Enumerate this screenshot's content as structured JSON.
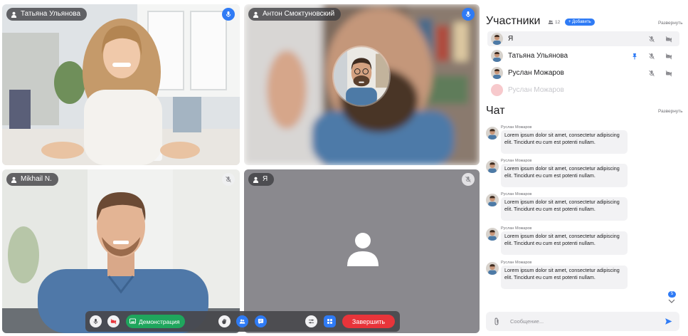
{
  "video_tiles": [
    {
      "name": "Татьяна Ульянова",
      "mic": "on"
    },
    {
      "name": "Антон Смоктуновский",
      "mic": "on"
    },
    {
      "name": "Mikhail N.",
      "mic": "off"
    },
    {
      "name": "Я",
      "mic": "off"
    }
  ],
  "controls": {
    "demo_label": "Демонстрация",
    "end_label": "Завершить"
  },
  "participants": {
    "title": "Участники",
    "count": "12",
    "add_label": "+ Добавить",
    "expand_label": "Развернуть",
    "items": [
      {
        "name": "Я"
      },
      {
        "name": "Татьяна Ульянова"
      },
      {
        "name": "Руслан Можаров"
      },
      {
        "name": "Руслан Можаров"
      }
    ]
  },
  "chat": {
    "title": "Чат",
    "expand_label": "Развернуть",
    "messages": [
      {
        "author": "Руслан Можаров",
        "text": "Lorem ipsum dolor sit amet, consectetur adipiscing elit. Tincidunt eu cum est potenti nullam."
      },
      {
        "author": "Руслан Можаров",
        "text": "Lorem ipsum dolor sit amet, consectetur adipiscing elit. Tincidunt eu cum est potenti nullam."
      },
      {
        "author": "Руслан Можаров",
        "text": "Lorem ipsum dolor sit amet, consectetur adipiscing elit. Tincidunt eu cum est potenti nullam."
      },
      {
        "author": "Руслан Можаров",
        "text": "Lorem ipsum dolor sit amet, consectetur adipiscing elit. Tincidunt eu cum est potenti nullam."
      },
      {
        "author": "Руслан Можаров",
        "text": "Lorem ipsum dolor sit amet, consectetur adipiscing elit. Tincidunt eu cum est potenti nullam."
      }
    ],
    "unread_count": "5",
    "input_placeholder": "Сообщение..."
  },
  "colors": {
    "accent": "#2f7bf5",
    "demo_green": "#1fa65d",
    "end_red": "#e8343a"
  }
}
